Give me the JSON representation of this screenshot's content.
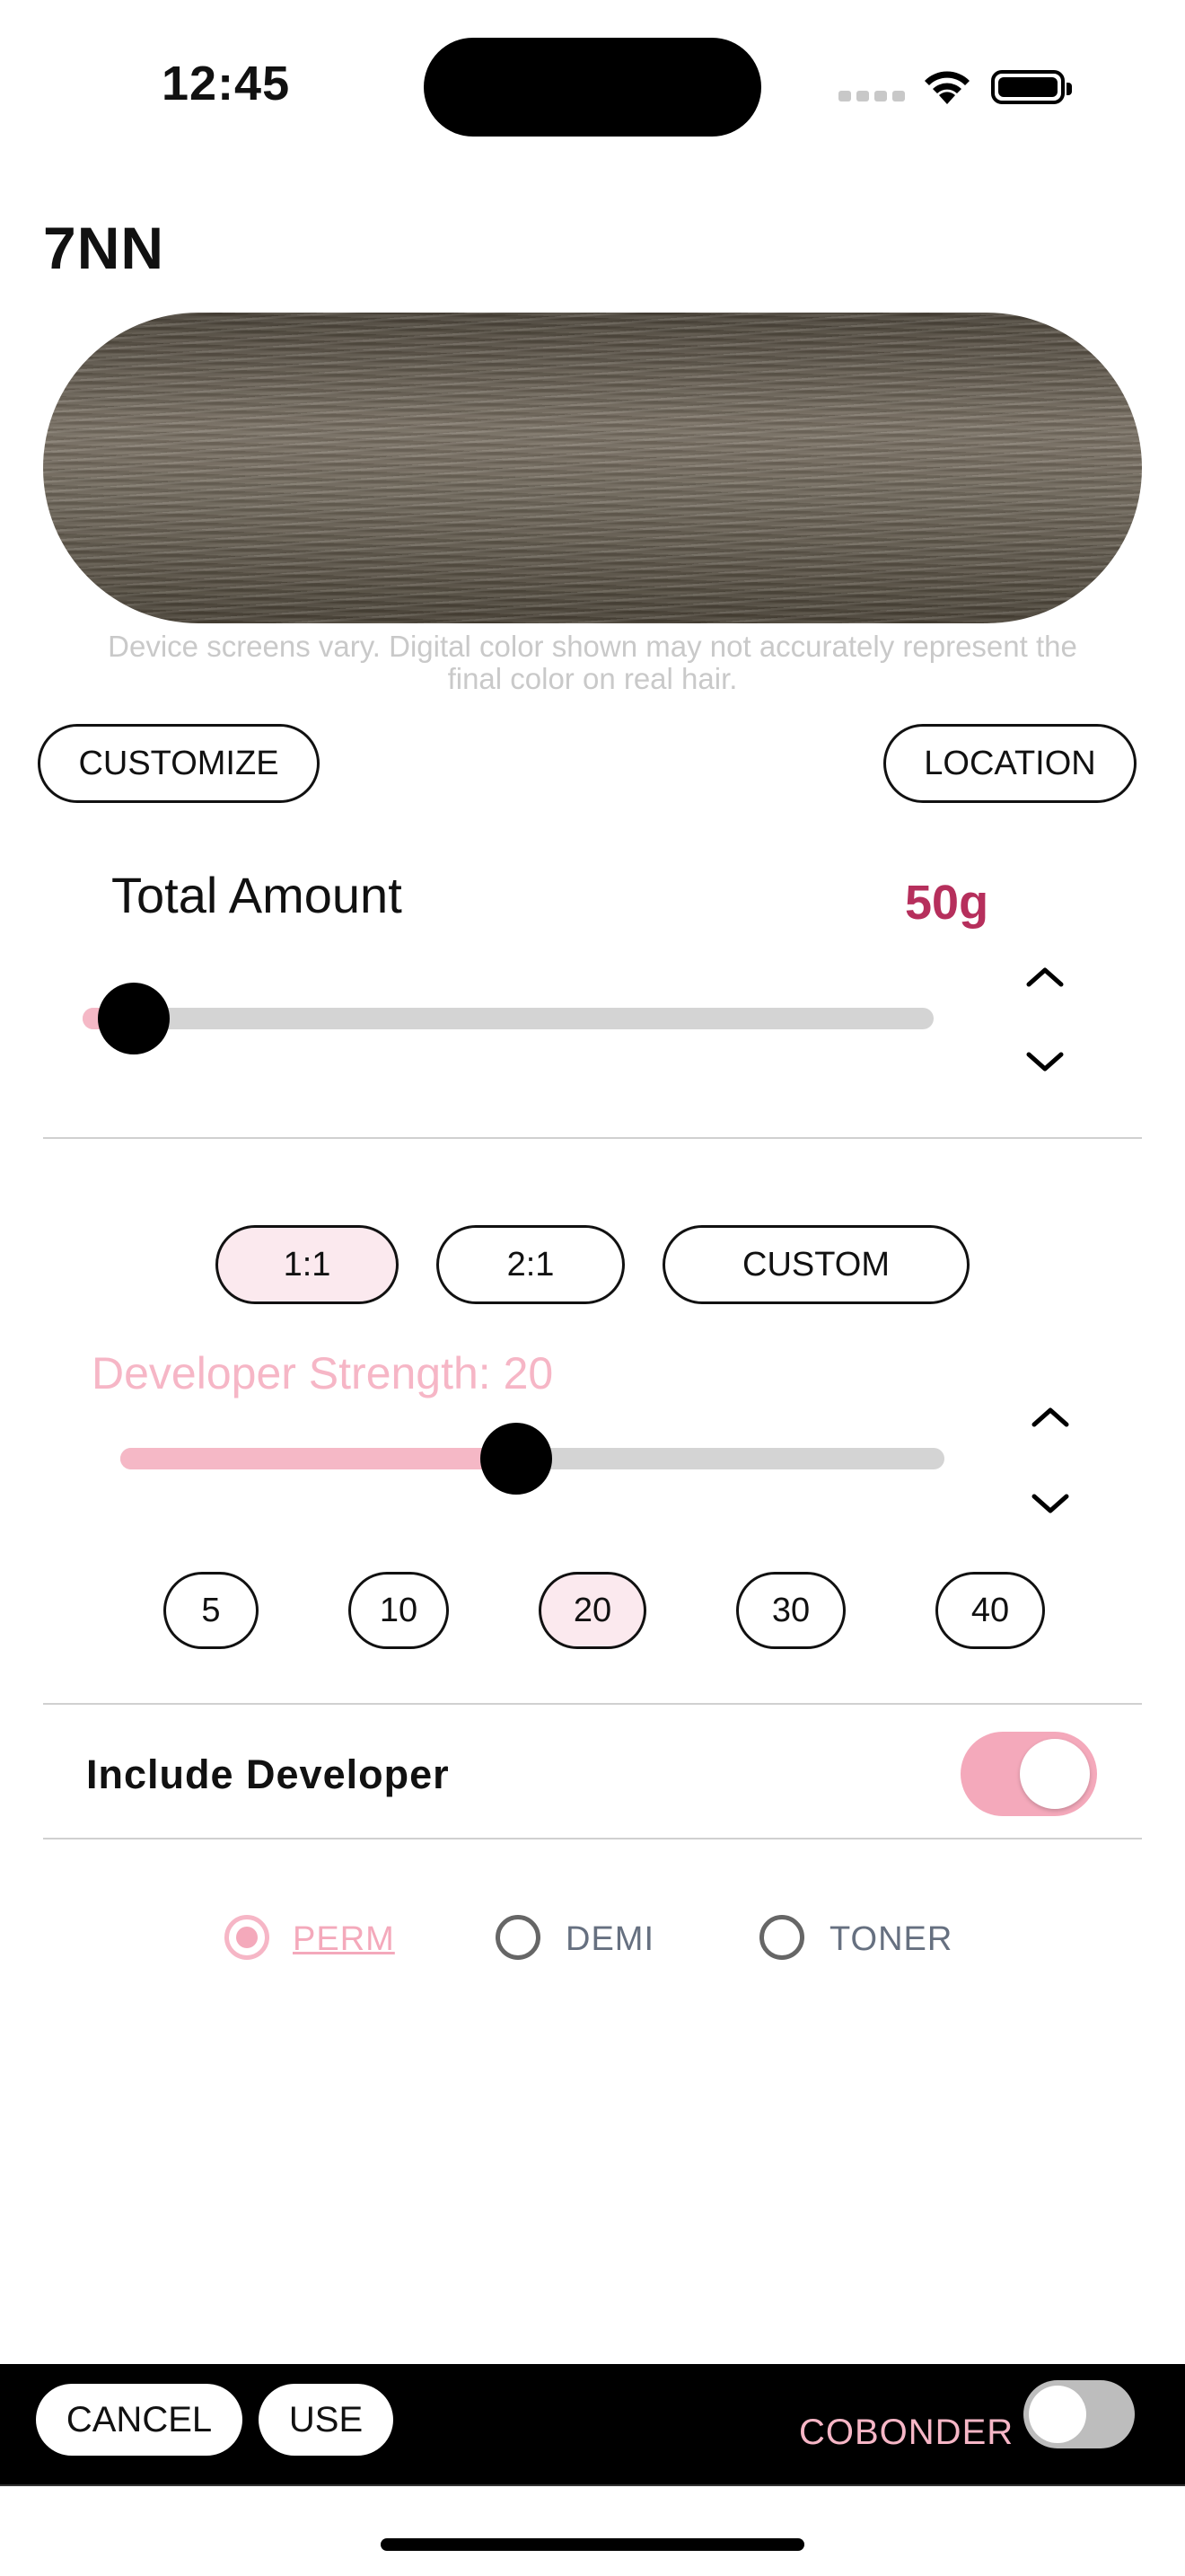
{
  "status_bar": {
    "time": "12:45"
  },
  "shade": {
    "name": "7NN",
    "swatch_color": "#6f675a"
  },
  "disclaimer": "Device screens vary. Digital color shown may not accurately represent the final color on real hair.",
  "actions": {
    "customize": "CUSTOMIZE",
    "location": "LOCATION"
  },
  "total_amount": {
    "label": "Total Amount",
    "value": "50g",
    "value_color": "#b62f5c",
    "slider_level": 0.06
  },
  "ratios": {
    "options": [
      "1:1",
      "2:1",
      "CUSTOM"
    ],
    "selected": "1:1"
  },
  "developer": {
    "label": "Developer Strength: 20",
    "slider_level": 0.48,
    "options": [
      "5",
      "10",
      "20",
      "30",
      "40"
    ],
    "selected": "20"
  },
  "include_developer": {
    "label": "Include Developer",
    "on": true
  },
  "color_type": {
    "options": [
      "PERM",
      "DEMI",
      "TONER"
    ],
    "selected": "PERM"
  },
  "bottom_bar": {
    "cancel": "CANCEL",
    "use": "USE",
    "cobonder_label": "COBONDER",
    "cobonder_on": false
  },
  "accent_color": "#f4a9bb"
}
